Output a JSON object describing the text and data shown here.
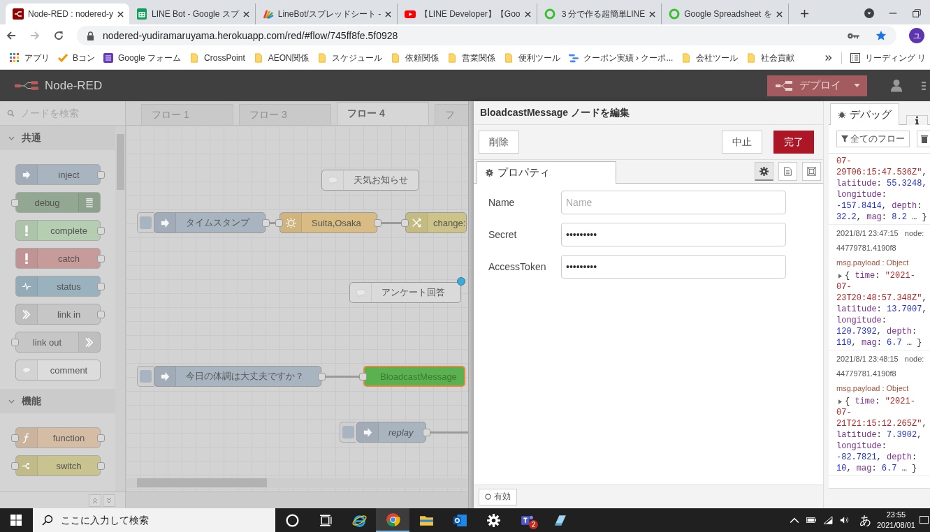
{
  "browser": {
    "tabs": [
      {
        "title": "Node-RED : nodered-y",
        "kind": "nodered",
        "selected": true
      },
      {
        "title": "LINE Bot - Google スプ",
        "kind": "sheets",
        "selected": false
      },
      {
        "title": "LineBot/スプレッドシート -",
        "kind": "colorful",
        "selected": false
      },
      {
        "title": "【LINE Developer】【Goo",
        "kind": "youtube",
        "selected": false
      },
      {
        "title": "３分で作る超簡単LINE",
        "kind": "ring",
        "selected": false
      },
      {
        "title": "Google Spreadsheet を",
        "kind": "ring",
        "selected": false
      }
    ],
    "url": "nodered-yudiramaruyama.herokuapp.com/red/#flow/745ff8fe.5f0928",
    "forward_disabled": true,
    "profile_initial": "ユ",
    "bookmarks": [
      {
        "label": "アプリ",
        "kind": "apps"
      },
      {
        "label": "Bコン",
        "kind": "check"
      },
      {
        "label": "Google フォーム",
        "kind": "forms"
      },
      {
        "label": "CrossPoint",
        "kind": "folder"
      },
      {
        "label": "AEON関係",
        "kind": "folder"
      },
      {
        "label": "スケジュール",
        "kind": "folder"
      },
      {
        "label": "依頼関係",
        "kind": "folder"
      },
      {
        "label": "営業関係",
        "kind": "folder"
      },
      {
        "label": "便利ツール",
        "kind": "folder"
      },
      {
        "label": "クーポン実績 › クーポ...",
        "kind": "dots"
      },
      {
        "label": "会社ツール",
        "kind": "folder"
      },
      {
        "label": "社会貢献",
        "kind": "folder"
      }
    ],
    "reading_list": "リーディング リ"
  },
  "header": {
    "title": "Node-RED",
    "deploy": "デプロイ"
  },
  "palette": {
    "search_placeholder": "ノードを検索",
    "categories": [
      {
        "name": "共通",
        "expanded": true,
        "nodes": [
          {
            "label": "inject",
            "kind": "inject",
            "color": "#a9b4c1",
            "input": false,
            "output": true,
            "icon_right": false
          },
          {
            "label": "debug",
            "kind": "debug",
            "color": "#93a892",
            "input": true,
            "output": false,
            "icon_right": true
          },
          {
            "label": "complete",
            "kind": "alert",
            "color": "#b5cdb1",
            "input": false,
            "output": true,
            "icon_right": false
          },
          {
            "label": "catch",
            "kind": "alert",
            "color": "#c89b9b",
            "input": false,
            "output": true,
            "icon_right": false
          },
          {
            "label": "status",
            "kind": "status",
            "color": "#9ab2be",
            "input": false,
            "output": true,
            "icon_right": false
          },
          {
            "label": "link in",
            "kind": "link",
            "color": "#c6c6c6",
            "input": false,
            "output": true,
            "icon_right": false
          },
          {
            "label": "link out",
            "kind": "link",
            "color": "#c6c6c6",
            "input": true,
            "output": false,
            "icon_right": true
          },
          {
            "label": "comment",
            "kind": "comment",
            "color": "#dcdcdc",
            "input": false,
            "output": false,
            "icon_right": false
          }
        ]
      },
      {
        "name": "機能",
        "expanded": true,
        "nodes": [
          {
            "label": "function",
            "kind": "function",
            "color": "#d4bca5",
            "input": true,
            "output": true,
            "icon_right": false
          },
          {
            "label": "switch",
            "kind": "switch",
            "color": "#c9c38f",
            "input": true,
            "output": true,
            "icon_right": false
          }
        ]
      }
    ]
  },
  "flow_tabs": [
    {
      "label": "フロー 1",
      "selected": false
    },
    {
      "label": "フロー 3",
      "selected": false
    },
    {
      "label": "フロー 4",
      "selected": true
    },
    {
      "label": "フ",
      "selected": false
    }
  ],
  "canvas_nodes": [
    {
      "label": "天気お知らせ",
      "kind": "comment",
      "color": "#dadada",
      "selected": false,
      "italic": false,
      "changed": false,
      "wire_out": false
    },
    {
      "label": "タイムスタンプ",
      "kind": "inject",
      "color": "#a9b4c1",
      "selected": false,
      "italic": false,
      "changed": false,
      "wire_out": true
    },
    {
      "label": "Suita,Osaka",
      "kind": "weather",
      "color": "#d8bc84",
      "selected": false,
      "italic": false,
      "changed": false,
      "wire_out": true
    },
    {
      "label": "change:",
      "kind": "change",
      "color": "#cbc388",
      "selected": false,
      "italic": false,
      "changed": false,
      "wire_out": false
    },
    {
      "label": "アンケート回答",
      "kind": "comment",
      "color": "#dadada",
      "selected": false,
      "italic": false,
      "changed": true,
      "wire_out": false
    },
    {
      "label": "今日の体調は大丈夫ですか？",
      "kind": "inject",
      "color": "#a9b4c1",
      "selected": false,
      "italic": false,
      "changed": false,
      "wire_out": true
    },
    {
      "label": "BloadcastMessage",
      "kind": "output",
      "color": "#5bb14f",
      "selected": true,
      "italic": false,
      "changed": false,
      "wire_out": false
    },
    {
      "label": "replay",
      "kind": "inject",
      "color": "#a9b4c1",
      "selected": false,
      "italic": true,
      "changed": false,
      "wire_out": true
    }
  ],
  "editor": {
    "title": "BloadcastMessage ノードを編集",
    "delete": "削除",
    "cancel": "中止",
    "done": "完了",
    "tab": "プロパティ",
    "fields": [
      {
        "label": "Name",
        "placeholder": "Name"
      },
      {
        "label": "Secret",
        "value": "•••••••••"
      },
      {
        "label": "AccessToken",
        "value": "•••••••••"
      }
    ],
    "enabled_label": "有効"
  },
  "sidebar": {
    "tabs": [
      {
        "label": "デバッグ",
        "kind": "debug",
        "selected": true
      },
      {
        "kind": "info",
        "selected": false
      }
    ],
    "filter": "全てのフロー",
    "messages": [
      {
        "lines": [
          [
            {
              "kind": "str",
              "text": "07-"
            }
          ],
          [
            {
              "kind": "str",
              "text": "29T06:15:47.536Z\""
            },
            {
              "kind": "punct",
              "text": ","
            }
          ],
          [
            {
              "kind": "key",
              "text": "latitude"
            },
            {
              "kind": "punct",
              "text": ": "
            },
            {
              "kind": "num",
              "text": "55.3248"
            },
            {
              "kind": "punct",
              "text": ","
            }
          ],
          [
            {
              "kind": "key",
              "text": "longitude"
            },
            {
              "kind": "punct",
              "text": ":"
            }
          ],
          [
            {
              "kind": "num",
              "text": "-157.8414"
            },
            {
              "kind": "punct",
              "text": ", "
            },
            {
              "kind": "key",
              "text": "depth"
            },
            {
              "kind": "punct",
              "text": ":"
            }
          ],
          [
            {
              "kind": "num",
              "text": "32.2"
            },
            {
              "kind": "punct",
              "text": ", "
            },
            {
              "kind": "key",
              "text": "mag"
            },
            {
              "kind": "punct",
              "text": ": "
            },
            {
              "kind": "num",
              "text": "8.2"
            },
            {
              "kind": "punct",
              "text": " … }"
            }
          ]
        ]
      },
      {
        "time": "2021/8/1 23:47:15",
        "node": "node: 44779781.4190f8",
        "type": "msg.payload : Object",
        "lines": [
          [
            {
              "kind": "punct",
              "text": "{ "
            },
            {
              "kind": "key",
              "text": "time"
            },
            {
              "kind": "punct",
              "text": ": "
            },
            {
              "kind": "str",
              "text": "\"2021-"
            }
          ],
          [
            {
              "kind": "str",
              "text": "07-"
            }
          ],
          [
            {
              "kind": "str",
              "text": "23T20:48:57.348Z\""
            },
            {
              "kind": "punct",
              "text": ","
            }
          ],
          [
            {
              "kind": "key",
              "text": "latitude"
            },
            {
              "kind": "punct",
              "text": ": "
            },
            {
              "kind": "num",
              "text": "13.7007"
            },
            {
              "kind": "punct",
              "text": ","
            }
          ],
          [
            {
              "kind": "key",
              "text": "longitude"
            },
            {
              "kind": "punct",
              "text": ":"
            }
          ],
          [
            {
              "kind": "num",
              "text": "120.7392"
            },
            {
              "kind": "punct",
              "text": ", "
            },
            {
              "kind": "key",
              "text": "depth"
            },
            {
              "kind": "punct",
              "text": ":"
            }
          ],
          [
            {
              "kind": "num",
              "text": "110"
            },
            {
              "kind": "punct",
              "text": ", "
            },
            {
              "kind": "key",
              "text": "mag"
            },
            {
              "kind": "punct",
              "text": ": "
            },
            {
              "kind": "num",
              "text": "6.7"
            },
            {
              "kind": "punct",
              "text": " … }"
            }
          ]
        ]
      },
      {
        "time": "2021/8/1 23:48:15",
        "node": "node: 44779781.4190f8",
        "type": "msg.payload : Object",
        "lines": [
          [
            {
              "kind": "punct",
              "text": "{ "
            },
            {
              "kind": "key",
              "text": "time"
            },
            {
              "kind": "punct",
              "text": ": "
            },
            {
              "kind": "str",
              "text": "\"2021-"
            }
          ],
          [
            {
              "kind": "str",
              "text": "07-"
            }
          ],
          [
            {
              "kind": "str",
              "text": "21T21:15:12.265Z\""
            },
            {
              "kind": "punct",
              "text": ","
            }
          ],
          [
            {
              "kind": "key",
              "text": "latitude"
            },
            {
              "kind": "punct",
              "text": ": "
            },
            {
              "kind": "num",
              "text": "7.3902"
            },
            {
              "kind": "punct",
              "text": ","
            }
          ],
          [
            {
              "kind": "key",
              "text": "longitude"
            },
            {
              "kind": "punct",
              "text": ":"
            }
          ],
          [
            {
              "kind": "num",
              "text": "-82.7821"
            },
            {
              "kind": "punct",
              "text": ", "
            },
            {
              "kind": "key",
              "text": "depth"
            },
            {
              "kind": "punct",
              "text": ":"
            }
          ],
          [
            {
              "kind": "num",
              "text": "10"
            },
            {
              "kind": "punct",
              "text": ", "
            },
            {
              "kind": "key",
              "text": "mag"
            },
            {
              "kind": "punct",
              "text": ": "
            },
            {
              "kind": "num",
              "text": "6.7"
            },
            {
              "kind": "punct",
              "text": " … }"
            }
          ]
        ]
      }
    ]
  },
  "taskbar": {
    "search_placeholder": "ここに入力して検索",
    "apps": [
      {
        "kind": "cortana",
        "active": false
      },
      {
        "kind": "taskview",
        "active": false
      },
      {
        "kind": "ie",
        "active": false
      },
      {
        "kind": "chrome",
        "active": true
      },
      {
        "kind": "explorer",
        "active": false
      },
      {
        "kind": "outlook",
        "active": false
      },
      {
        "kind": "settings",
        "active": false
      },
      {
        "kind": "teams",
        "active": false,
        "badge": "2"
      },
      {
        "kind": "notes",
        "active": false
      }
    ],
    "ime": "あ",
    "time": "23:55",
    "date": "2021/08/01"
  }
}
